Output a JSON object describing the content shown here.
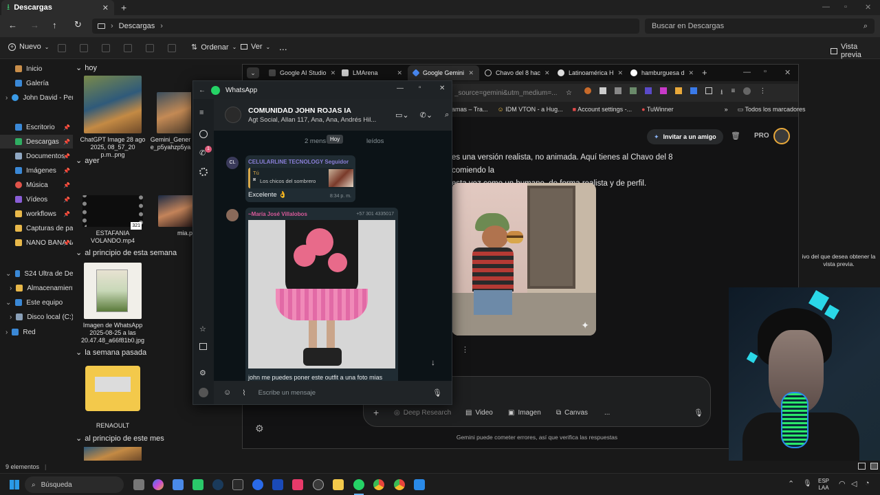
{
  "explorer": {
    "tab_title": "Descargas",
    "address": "Descargas",
    "search_placeholder": "Buscar en Descargas",
    "toolbar": {
      "new": "Nuevo",
      "sort": "Ordenar",
      "view": "Ver",
      "more": "...",
      "preview": "Vista previa"
    },
    "nav": {
      "inicio": "Inicio",
      "galeria": "Galería",
      "onedrive": "John David - Persor",
      "escritorio": "Escritorio",
      "descargas": "Descargas",
      "documentos": "Documentos",
      "imagenes": "Imágenes",
      "musica": "Música",
      "videos": "Vídeos",
      "workflows": "workflows",
      "capturas": "Capturas de pan",
      "nano": "NANO BANANA",
      "phone": "S24 Ultra de Deivjho",
      "almacenamiento": "Almacenamiento",
      "equipo": "Este equipo",
      "disco": "Disco local (C:)",
      "red": "Red"
    },
    "groups": {
      "hoy": "hoy",
      "ayer": "ayer",
      "principio_semana": "al principio de esta semana",
      "semana_pasada": "la semana pasada",
      "principio_mes": "al principio de este mes"
    },
    "files": {
      "f1": "ChatGPT Image 28 ago 2025, 08_57_20 p.m..png",
      "f2": "Gemini_Gener e_p5yahzp5ya",
      "f3": "ESTAFANIA VOLANDO.mp4",
      "f3_badge": "321",
      "f4": "mia.p",
      "f5": "Imagen de WhatsApp 2025-08-25 a las 20.47.48_a66f81b0.jpg",
      "f6": "RENAOULT"
    },
    "status": "9 elementos"
  },
  "chrome": {
    "tabs": [
      "Google AI Studio",
      "LMArena",
      "Google Gemini",
      "Chavo del 8 hac",
      "Latinoamérica H",
      "hamburguesa d"
    ],
    "url_fragment": "_source=gemini&utm_medium=...",
    "bookmarks": [
      "amas – Tra...",
      "IDM VTON - a Hug...",
      "Account settings -...",
      "TuWinner",
      "»",
      "Todos los marcadores"
    ],
    "invite": "Invitar a un amigo",
    "pro": "PRO",
    "response_line1": "es una versión realista, no animada. Aquí tienes al Chavo del 8 comiendo la",
    "response_line2": "esta vez como un humano, de forma realista y de perfil.",
    "prompt_tools": [
      "Deep Research",
      "Video",
      "Imagen",
      "Canvas",
      "..."
    ],
    "disclaimer": "Gemini puede cometer errores, así que verifica las respuestas"
  },
  "whatsapp": {
    "app_title": "WhatsApp",
    "chat_name": "COMUNIDAD JOHN ROJAS IA",
    "members": "Agt Social, Allan 117, Ana, Ana, Andrés Hil...",
    "unread_banner": "2 mens",
    "unread_banner_end": "leídos",
    "tooltip": "Hoy",
    "msg1": {
      "sender": "CELULARLINE TECNOLOGY Seguidor",
      "quote_author": "Tú",
      "quote_text": "Los chicos del sombrero",
      "text": "Excelente 👌",
      "time": "8:34 p. m."
    },
    "msg2": {
      "sender": "~María José Villalobos",
      "phone": "+57 301 4335017",
      "caption": "john me puedes poner  este  outfit a una foto mias"
    },
    "input_placeholder": "Escribe un mensaje",
    "call_badge": "1"
  },
  "desktop": {
    "side_note": "ivo del que desea obtener la vista previa."
  },
  "taskbar": {
    "search": "Búsqueda",
    "lang1": "ESP",
    "lang2": "LAA"
  }
}
